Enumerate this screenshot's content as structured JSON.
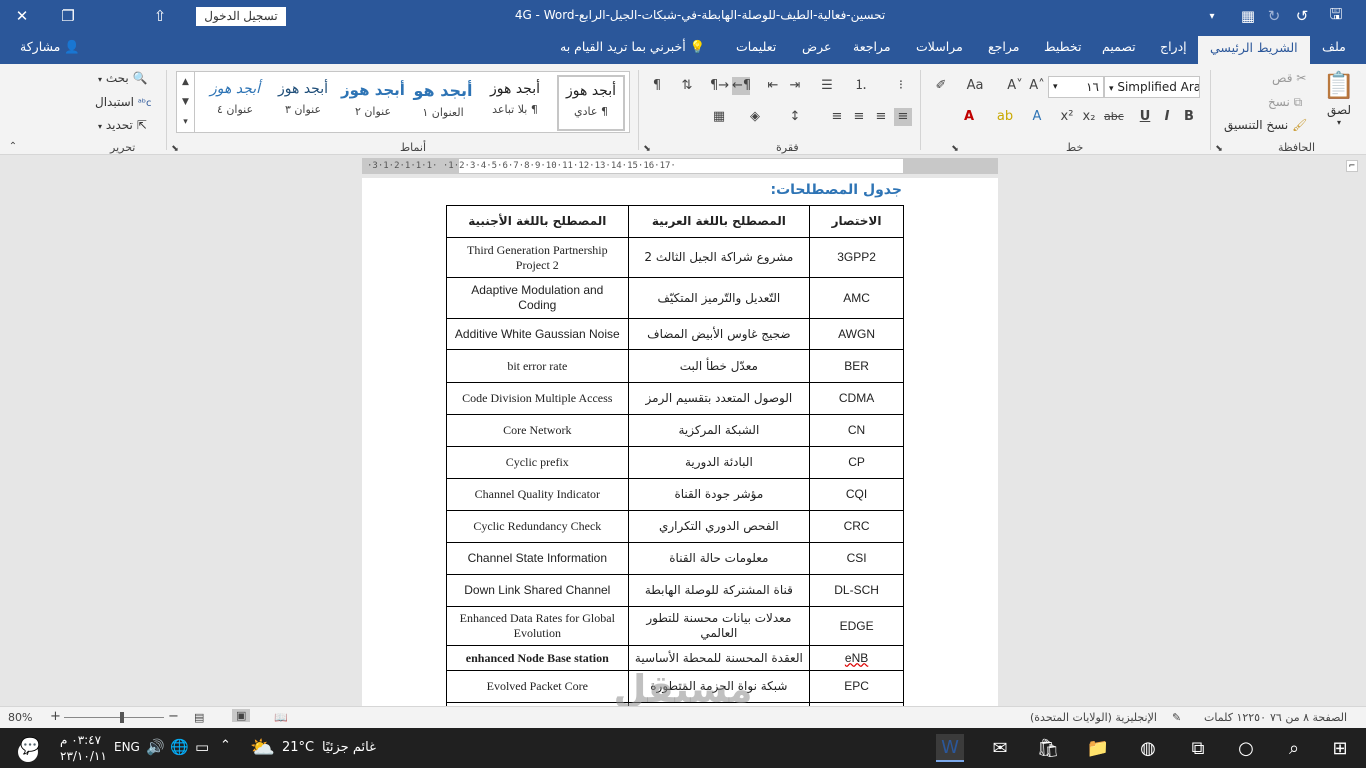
{
  "titlebar": {
    "doc_title": "تحسين-فعالية-الطيف-للوصلة-الهابطة-في-شبكات-الجيل-الرابع-4G  -  Word",
    "signin": "تسجيل الدخول"
  },
  "menu": {
    "file": "ملف",
    "home": "الشريط الرئيسي",
    "insert": "إدراج",
    "design": "تصميم",
    "layout": "تخطيط",
    "references": "مراجع",
    "mailings": "مراسلات",
    "review": "مراجعة",
    "view": "عرض",
    "help": "تعليمات",
    "tellme": "أخبرني بما تريد القيام به",
    "share": "مشاركة"
  },
  "ribbon": {
    "clipboard": {
      "label": "الحافظة",
      "paste": "لصق",
      "cut": "قص",
      "copy": "نسخ",
      "format_painter": "نسخ التنسيق"
    },
    "font": {
      "label": "خط",
      "name": "Simplified Ara",
      "size": "١٦"
    },
    "paragraph": {
      "label": "فقرة"
    },
    "styles": {
      "label": "أنماط",
      "items": [
        {
          "preview": "أبجد هوز",
          "name": "¶ عادي"
        },
        {
          "preview": "أبجد هوز",
          "name": "¶ بلا تباعد"
        },
        {
          "preview": "أبجد هو",
          "name": "العنوان ١"
        },
        {
          "preview": "أبجد هوز",
          "name": "عنوان ٢"
        },
        {
          "preview": "أبجد هوز",
          "name": "عنوان ٣"
        },
        {
          "preview": "أبجد هوز",
          "name": "عنوان ٤"
        }
      ]
    },
    "editing": {
      "label": "تحرير",
      "find": "بحث",
      "replace": "استبدال",
      "select": "تحديد"
    }
  },
  "ruler": {
    "text": "·3·1·2·1·1·1·   ·1·2·3·4·5·6·7·8·9·10·11·12·13·14·15·16·17·"
  },
  "document": {
    "heading": "جدول المصطلحات:",
    "headers": {
      "abbr": "الاختصار",
      "arabic": "المصطلح باللغة العربية",
      "english": "المصطلح باللغة الأجنبية"
    },
    "rows": [
      {
        "abbr": "3GPP2",
        "arabic": "مشروع شراكة الجيل الثالث 2",
        "english": "Third Generation Partnership Project 2"
      },
      {
        "abbr": "AMC",
        "arabic": "التّعديل والتّرميز المتكيّف",
        "english": "Adaptive Modulation and Coding"
      },
      {
        "abbr": "AWGN",
        "arabic": "ضجيج غاوس الأبيض المضاف",
        "english": "Additive White Gaussian Noise"
      },
      {
        "abbr": "BER",
        "arabic": "معدّل خطأ البت",
        "english": "bit error rate"
      },
      {
        "abbr": "CDMA",
        "arabic": "الوصول المتعدد بتقسيم الرمز",
        "english": "Code Division Multiple Access"
      },
      {
        "abbr": "CN",
        "arabic": "الشبكة المركزية",
        "english": "Core Network"
      },
      {
        "abbr": "CP",
        "arabic": "البادئة الدورية",
        "english": "Cyclic prefix"
      },
      {
        "abbr": "CQI",
        "arabic": "مؤشر جودة القناة",
        "english": "Channel Quality Indicator"
      },
      {
        "abbr": "CRC",
        "arabic": "الفحص الدوري التكراري",
        "english": "Cyclic Redundancy Check"
      },
      {
        "abbr": "CSI",
        "arabic": "معلومات حالة القناة",
        "english": "Channel State Information"
      },
      {
        "abbr": "DL-SCH",
        "arabic": "قناة المشتركة للوصلة الهابطة",
        "english": "Down Link Shared Channel"
      },
      {
        "abbr": "EDGE",
        "arabic": "معدلات بيانات محسنة للتطور العالمي",
        "english": "Enhanced Data Rates for Global Evolution"
      },
      {
        "abbr": "eNB",
        "arabic": "العقدة المحسنة للمحطة الأساسية",
        "english": "enhanced Node Base station"
      },
      {
        "abbr": "EPC",
        "arabic": "شبكة نواة الحزمة المتطورة",
        "english": "Evolved Packet Core"
      }
    ]
  },
  "statusbar": {
    "page": "الصفحة ٨ من ٧٦",
    "words": "١٢٢٥٠ كلمات",
    "language": "الإنجليزية (الولايات المتحدة)",
    "zoom": "80%"
  },
  "taskbar": {
    "time": "٠٣:٤٧ م",
    "date": "٢٣/١٠/١١",
    "lang": "ENG",
    "temp": "21°C",
    "weather": "غائم جزئيًا",
    "notif_count": "7"
  },
  "watermark": {
    "brand_ar": "مستقل",
    "brand_en": "mostaql.com"
  },
  "colors": {
    "word_blue": "#2b579a",
    "heading_blue": "#2e74b5",
    "taskbar": "#202020"
  }
}
